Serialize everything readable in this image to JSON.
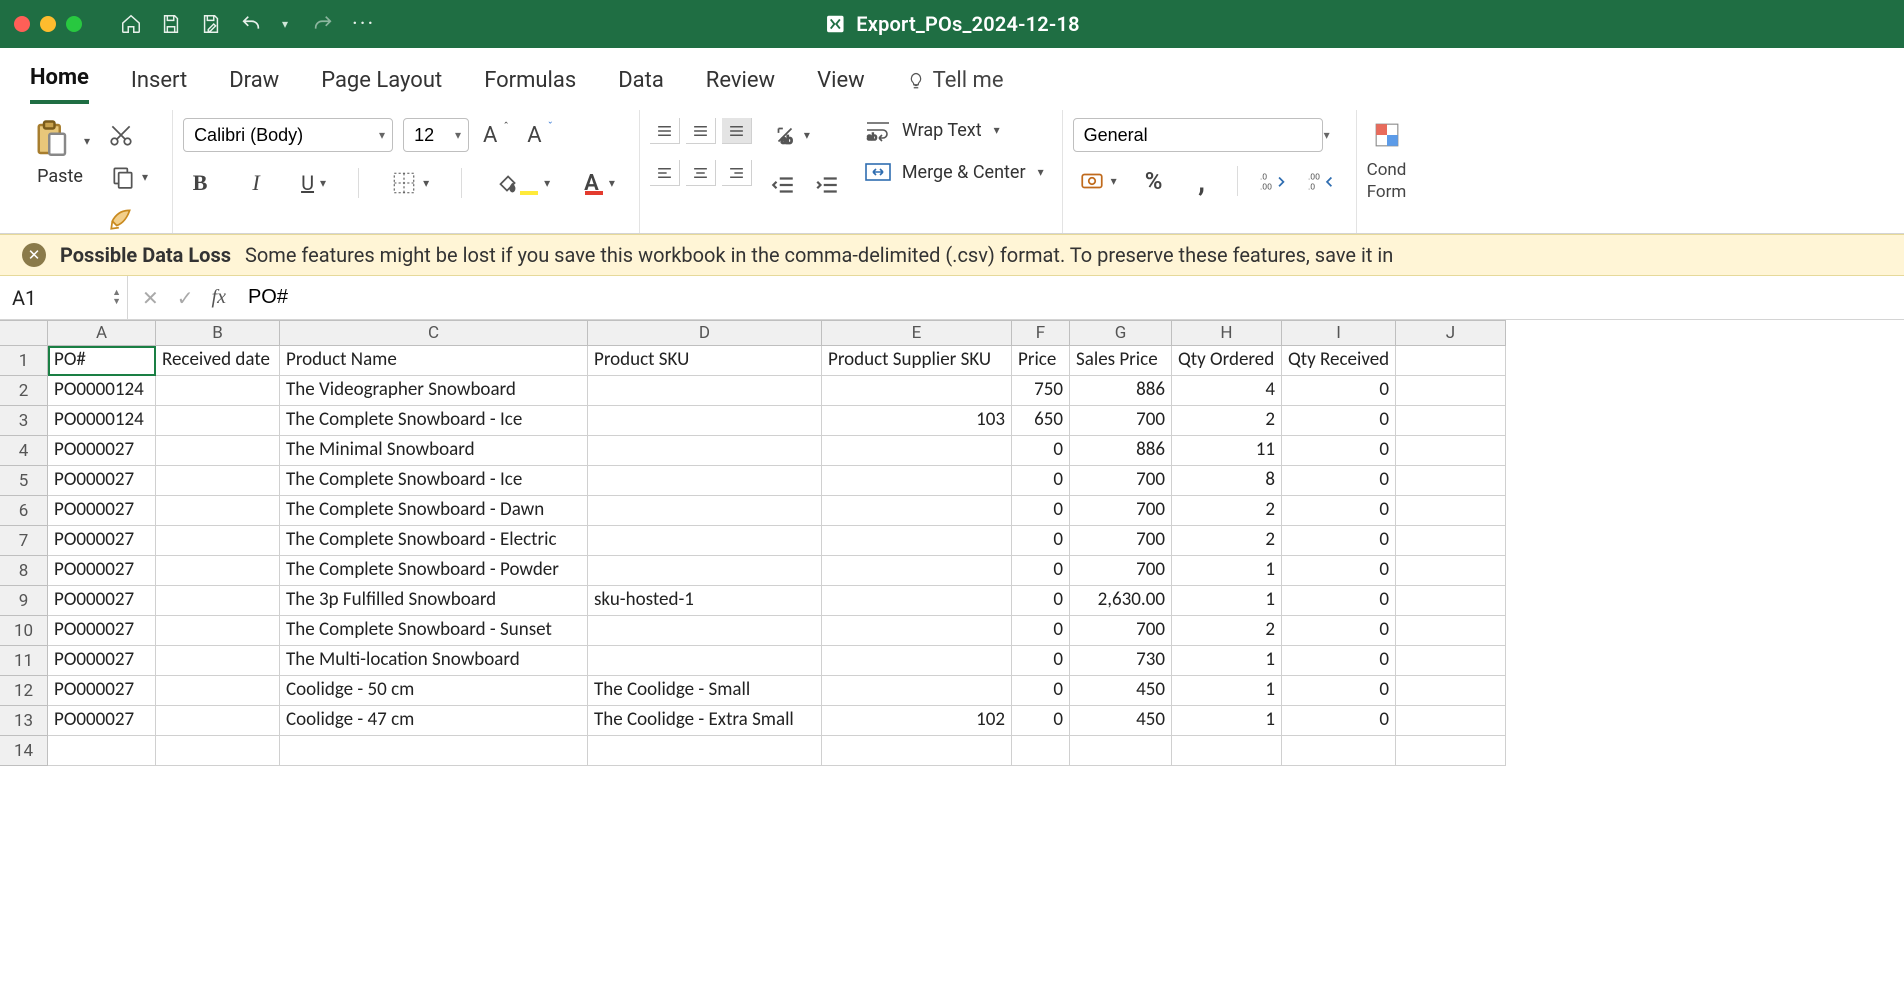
{
  "app": {
    "file_title": "Export_POs_2024-12-18"
  },
  "tabs": {
    "items": [
      "Home",
      "Insert",
      "Draw",
      "Page Layout",
      "Formulas",
      "Data",
      "Review",
      "View"
    ],
    "active_index": 0,
    "tell_me": "Tell me"
  },
  "ribbon": {
    "paste_label": "Paste",
    "font_name": "Calibri (Body)",
    "font_size": "12",
    "wrap_text": "Wrap Text",
    "merge_center": "Merge & Center",
    "number_format": "General",
    "cond_fmt_1": "Cond",
    "cond_fmt_2": "Form"
  },
  "warning": {
    "title": "Possible Data Loss",
    "body": "Some features might be lost if you save this workbook in the comma-delimited (.csv) format. To preserve these features, save it in"
  },
  "formula_bar": {
    "cell_ref": "A1",
    "fx_label": "fx",
    "value": "PO#"
  },
  "grid": {
    "columns": [
      "A",
      "B",
      "C",
      "D",
      "E",
      "F",
      "G",
      "H",
      "I",
      "J"
    ],
    "headers": [
      "PO#",
      "Received date",
      "Product Name",
      "Product SKU",
      "Product Supplier SKU",
      "Price",
      "Sales Price",
      "Qty Ordered",
      "Qty Received"
    ],
    "rows": [
      {
        "po": "PO0000124",
        "received": "",
        "name": "The Videographer Snowboard",
        "sku": "",
        "supplier_sku": "",
        "price": "750",
        "sales": "886",
        "ordered": "4",
        "recv": "0"
      },
      {
        "po": "PO0000124",
        "received": "",
        "name": "The Complete Snowboard - Ice",
        "sku": "",
        "supplier_sku": "103",
        "price": "650",
        "sales": "700",
        "ordered": "2",
        "recv": "0"
      },
      {
        "po": "PO000027",
        "received": "",
        "name": "The Minimal Snowboard",
        "sku": "",
        "supplier_sku": "",
        "price": "0",
        "sales": "886",
        "ordered": "11",
        "recv": "0"
      },
      {
        "po": "PO000027",
        "received": "",
        "name": "The Complete Snowboard - Ice",
        "sku": "",
        "supplier_sku": "",
        "price": "0",
        "sales": "700",
        "ordered": "8",
        "recv": "0"
      },
      {
        "po": "PO000027",
        "received": "",
        "name": "The Complete Snowboard - Dawn",
        "sku": "",
        "supplier_sku": "",
        "price": "0",
        "sales": "700",
        "ordered": "2",
        "recv": "0"
      },
      {
        "po": "PO000027",
        "received": "",
        "name": "The Complete Snowboard - Electric",
        "sku": "",
        "supplier_sku": "",
        "price": "0",
        "sales": "700",
        "ordered": "2",
        "recv": "0"
      },
      {
        "po": "PO000027",
        "received": "",
        "name": "The Complete Snowboard - Powder",
        "sku": "",
        "supplier_sku": "",
        "price": "0",
        "sales": "700",
        "ordered": "1",
        "recv": "0"
      },
      {
        "po": "PO000027",
        "received": "",
        "name": "The 3p Fulfilled Snowboard",
        "sku": "sku-hosted-1",
        "supplier_sku": "",
        "price": "0",
        "sales": "2,630.00",
        "ordered": "1",
        "recv": "0"
      },
      {
        "po": "PO000027",
        "received": "",
        "name": "The Complete Snowboard - Sunset",
        "sku": "",
        "supplier_sku": "",
        "price": "0",
        "sales": "700",
        "ordered": "2",
        "recv": "0"
      },
      {
        "po": "PO000027",
        "received": "",
        "name": "The Multi-location Snowboard",
        "sku": "",
        "supplier_sku": "",
        "price": "0",
        "sales": "730",
        "ordered": "1",
        "recv": "0"
      },
      {
        "po": "PO000027",
        "received": "",
        "name": "Coolidge - 50 cm",
        "sku": "The Coolidge - Small",
        "supplier_sku": "",
        "price": "0",
        "sales": "450",
        "ordered": "1",
        "recv": "0"
      },
      {
        "po": "PO000027",
        "received": "",
        "name": "Coolidge - 47 cm",
        "sku": "The Coolidge - Extra Small",
        "supplier_sku": "102",
        "price": "0",
        "sales": "450",
        "ordered": "1",
        "recv": "0"
      }
    ],
    "empty_rows": 1
  }
}
